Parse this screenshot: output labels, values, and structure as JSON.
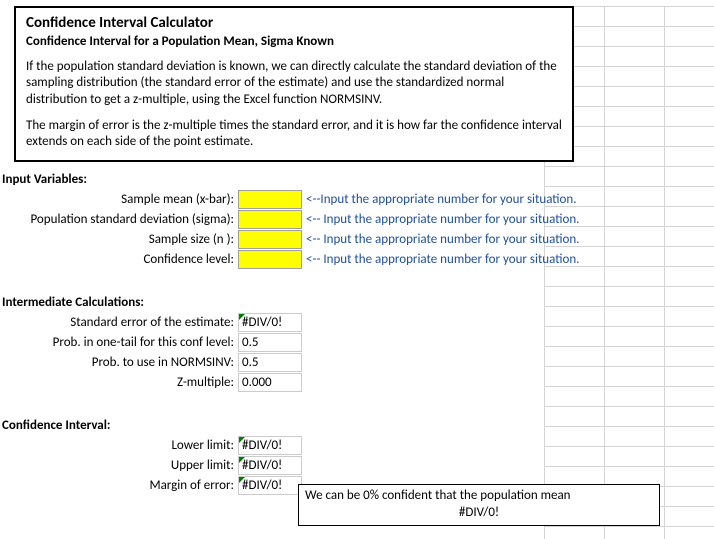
{
  "header": {
    "title": "Confidence Interval Calculator",
    "subtitle": "Confidence Interval for a Population Mean, Sigma Known",
    "para1": "If the population standard deviation is known, we can directly calculate the  standard deviation of the sampling distribution (the standard error of the estimate) and use the standardized normal distribution to get a z-multiple, using the Excel function NORMSINV.",
    "para2": "The margin of error is the z-multiple times the standard error, and it is how far the confidence interval extends on each side of the point estimate."
  },
  "sections": {
    "inputs": "Input Variables:",
    "intermediate": "Intermediate Calculations:",
    "ci": "Confidence Interval:"
  },
  "inputs": {
    "xbar": {
      "label": "Sample mean (x-bar):",
      "value": "",
      "hint": "<--Input the appropriate number for your situation."
    },
    "sigma": {
      "label": "Population standard deviation (sigma):",
      "value": "",
      "hint": "<-- Input the appropriate number for your situation."
    },
    "n": {
      "label": "Sample size (n ):",
      "value": "",
      "hint": "<-- Input the appropriate number for your situation."
    },
    "conf": {
      "label": "Confidence level:",
      "value": "",
      "hint": "<-- Input the appropriate number for your situation."
    }
  },
  "intermediate": {
    "se": {
      "label": "Standard error of the estimate:",
      "value": "#DIV/0!"
    },
    "p1": {
      "label": "Prob. in one-tail for this conf level:",
      "value": "0.5"
    },
    "p2": {
      "label": "Prob. to use in NORMSINV:",
      "value": "0.5"
    },
    "z": {
      "label": "Z-multiple:",
      "value": "0.000"
    }
  },
  "ci": {
    "lower": {
      "label": "Lower limit:",
      "value": "#DIV/0!"
    },
    "upper": {
      "label": "Upper limit:",
      "value": "#DIV/0!"
    },
    "me": {
      "label": "Margin of error:",
      "value": "#DIV/0!"
    }
  },
  "statement": {
    "line1": "We can be 0% confident that the population mean",
    "line2": "#DIV/0!"
  }
}
